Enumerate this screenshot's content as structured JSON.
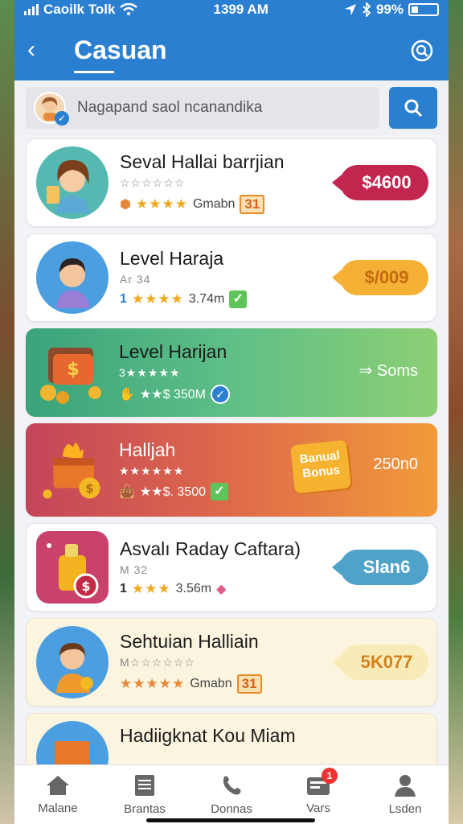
{
  "status_bar": {
    "carrier": "Caoilk Tolk",
    "time": "1399 AM",
    "battery": "99%"
  },
  "header": {
    "title": "Casuan"
  },
  "search": {
    "placeholder": "Nagapand saol ncanandika"
  },
  "cards": [
    {
      "title": "Seval Hallai barrjian",
      "subtitle": "",
      "meta": "Gmabn",
      "badge": "31",
      "price": "$4600",
      "stars": "★★★★"
    },
    {
      "title": "Level Haraja",
      "subtitle": "Ar 34",
      "meta": "3.74m",
      "stars": "★★★★",
      "price": "$/009",
      "lead": "1"
    },
    {
      "title": "Level Harijan",
      "subtitle": "3★★★★★",
      "meta": "★★$ 350M",
      "price": "Soms"
    },
    {
      "title": "Halljah",
      "subtitle": "★★★★★★",
      "meta": "★★$. 3500",
      "bonus": "Banual Bonus",
      "price": "250n0"
    },
    {
      "title": "Asvalı Raday Caftara)",
      "subtitle": "M 32",
      "meta": "3.56m",
      "stars": "★★★",
      "price": "Slan6",
      "lead": "1"
    },
    {
      "title": "Sehtuian Halliain",
      "subtitle": "M",
      "meta": "Gmabn",
      "badge": "31",
      "stars": "★★★★★",
      "price": "5K077"
    },
    {
      "title": "Hadiigknat Kou Miam"
    }
  ],
  "tabs": [
    {
      "label": "Malane"
    },
    {
      "label": "Brantas"
    },
    {
      "label": "Donnas"
    },
    {
      "label": "Vars",
      "badge": "1"
    },
    {
      "label": "Lsden"
    }
  ],
  "colors": {
    "primary": "#2b7fd1",
    "price_red": "#c2264f",
    "price_yellow": "#f4b135",
    "price_blue": "#4fa3c9"
  }
}
